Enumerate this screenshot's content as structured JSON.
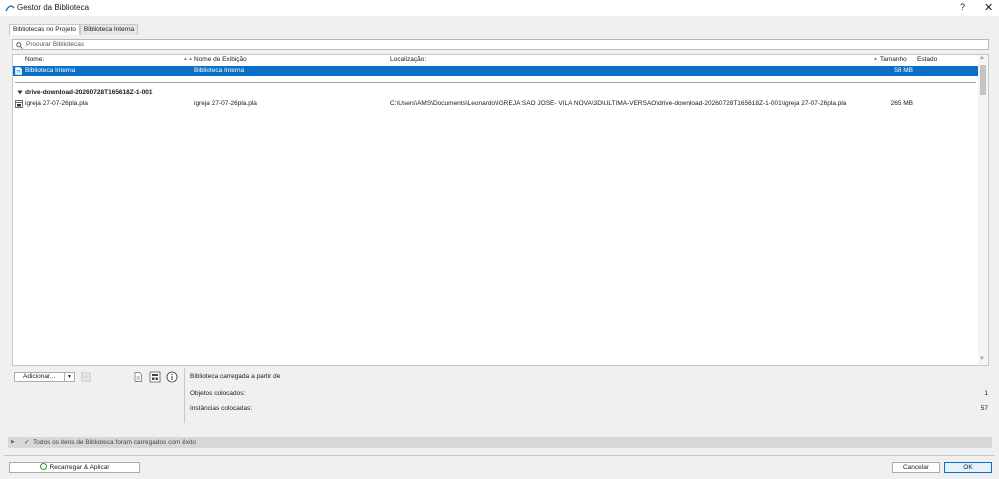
{
  "window": {
    "title": "Gestor da Biblioteca",
    "help": "?",
    "close": "✕"
  },
  "tabs": [
    {
      "label": "Bibliotecas no Projeto"
    },
    {
      "label": "Biblioteca Interna"
    }
  ],
  "search": {
    "placeholder": "Procurar Bibliotecas",
    "value": ""
  },
  "columns": {
    "name": "Nome:",
    "display_name": "Nome de Exibição",
    "location": "Localização:",
    "size": "Tamanho",
    "status": "Estado"
  },
  "rows": [
    {
      "name": "Biblioteca Interna",
      "display_name": "Biblioteca Interna",
      "location": "",
      "size": "58 MB",
      "status": ""
    }
  ],
  "groups": [
    {
      "label": "drive-download-20260728T165618Z-1-001",
      "rows": [
        {
          "name": "igreja 27-07-26pla.pla",
          "display_name": "igreja 27-07-26pla.pla",
          "location": "C:\\Users\\AMS\\Documents\\Leonardo\\IGREJA SAO JOSE- VILA NOVA\\3D\\ULTIMA-VERSAO\\drive-download-20260728T165618Z-1-001\\igreja 27-07-26pla.pla",
          "size": "265 MB",
          "status": ""
        }
      ]
    }
  ],
  "toolbar": {
    "add_label": "Adicionar..."
  },
  "info": {
    "loaded_from": "Biblioteca carregada a partir de",
    "objects_label": "Objetos colocados:",
    "objects_value": "1",
    "instances_label": "Instâncias colocadas:",
    "instances_value": "57"
  },
  "status": {
    "message": "Todos os itens de Biblioteca foram carregados com êxito"
  },
  "buttons": {
    "reload": "Recarregar & Aplicar",
    "cancel": "Cancelar",
    "ok": "OK"
  },
  "colors": {
    "selection": "#0a6fc7",
    "accent_green": "#2c9a3a"
  }
}
